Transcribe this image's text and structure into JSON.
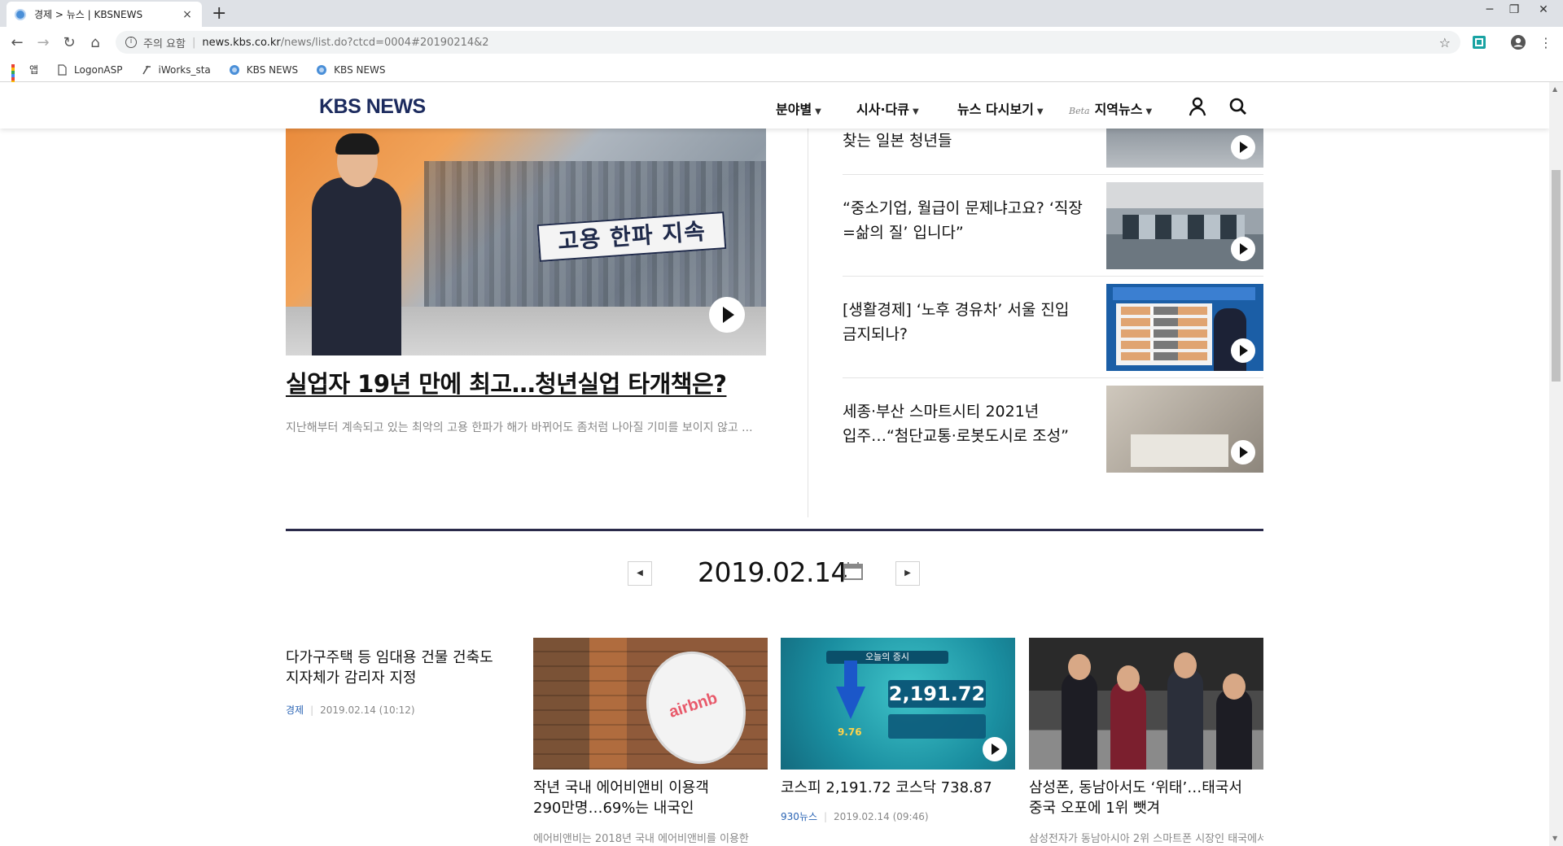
{
  "browser": {
    "tab_title": "경제 > 뉴스 | KBSNEWS",
    "tab_close": "×",
    "new_tab": "+",
    "url_warning": "주의 요함",
    "url_host": "news.kbs.co.kr",
    "url_path": "/news/list.do?ctcd=0004#20190214&2",
    "bookmarks": [
      {
        "label": "앱",
        "icon": "apps-icon"
      },
      {
        "label": "LogonASP",
        "icon": "page-icon"
      },
      {
        "label": "iWorks_sta",
        "icon": "iworks-icon"
      },
      {
        "label": "KBS NEWS",
        "icon": "kbs-icon"
      },
      {
        "label": "KBS NEWS",
        "icon": "kbs-icon"
      }
    ]
  },
  "site": {
    "logo": "KBS NEWS",
    "nav": [
      {
        "label": "분야별"
      },
      {
        "label": "시사·다큐"
      },
      {
        "label": "뉴스 다시보기"
      },
      {
        "label": "지역뉴스",
        "badge": "Beta"
      }
    ],
    "brand_color": "#1c2b5e"
  },
  "featured": {
    "banner_text": "고용 한파 지속",
    "title": "실업자 19년 만에 최고…청년실업 타개책은?",
    "summary": "지난해부터 계속되고 있는 최악의 고용 한파가 해가 바뀌어도 좀처럼 나아질 기미를 보이지 않고 ..."
  },
  "side_list": [
    {
      "title": "찾는 일본 청년들"
    },
    {
      "title": "“중소기업, 월급이 문제냐고요? ‘직장=삶의 질’ 입니다”"
    },
    {
      "title": "[생활경제] ‘노후 경유차’ 서울 진입 금지되나?"
    },
    {
      "title": "세종·부산 스마트시티 2021년 입주…“첨단교통·로봇도시로 조성”"
    }
  ],
  "date_nav": {
    "date": "2019.02.14",
    "prev": "◀",
    "next": "▶"
  },
  "cards": [
    {
      "title": "다가구주택 등 임대용 건물 건축도 지자체가 감리자 지정",
      "category": "경제",
      "datetime": "2019.02.14 (10:12)"
    },
    {
      "title": "작년 국내 에어비앤비 이용객 290만명…69%는 내국인",
      "brand": "airbnb",
      "desc": "에어비앤비는 2018년 국내 에어비앤비를 이용한"
    },
    {
      "title": "코스피 2,191.72 코스닥 738.87",
      "category": "930뉴스",
      "datetime": "2019.02.14 (09:46)",
      "banner": "오늘의 증시",
      "index_value": "2,191.72",
      "change": "9.76"
    },
    {
      "title": "삼성폰, 동남아서도 ‘위태’…태국서 중국 오포에 1위 뺏겨",
      "desc": "삼성전자가 동남아시아 2위 스마트폰 시장인 태국에서"
    }
  ]
}
